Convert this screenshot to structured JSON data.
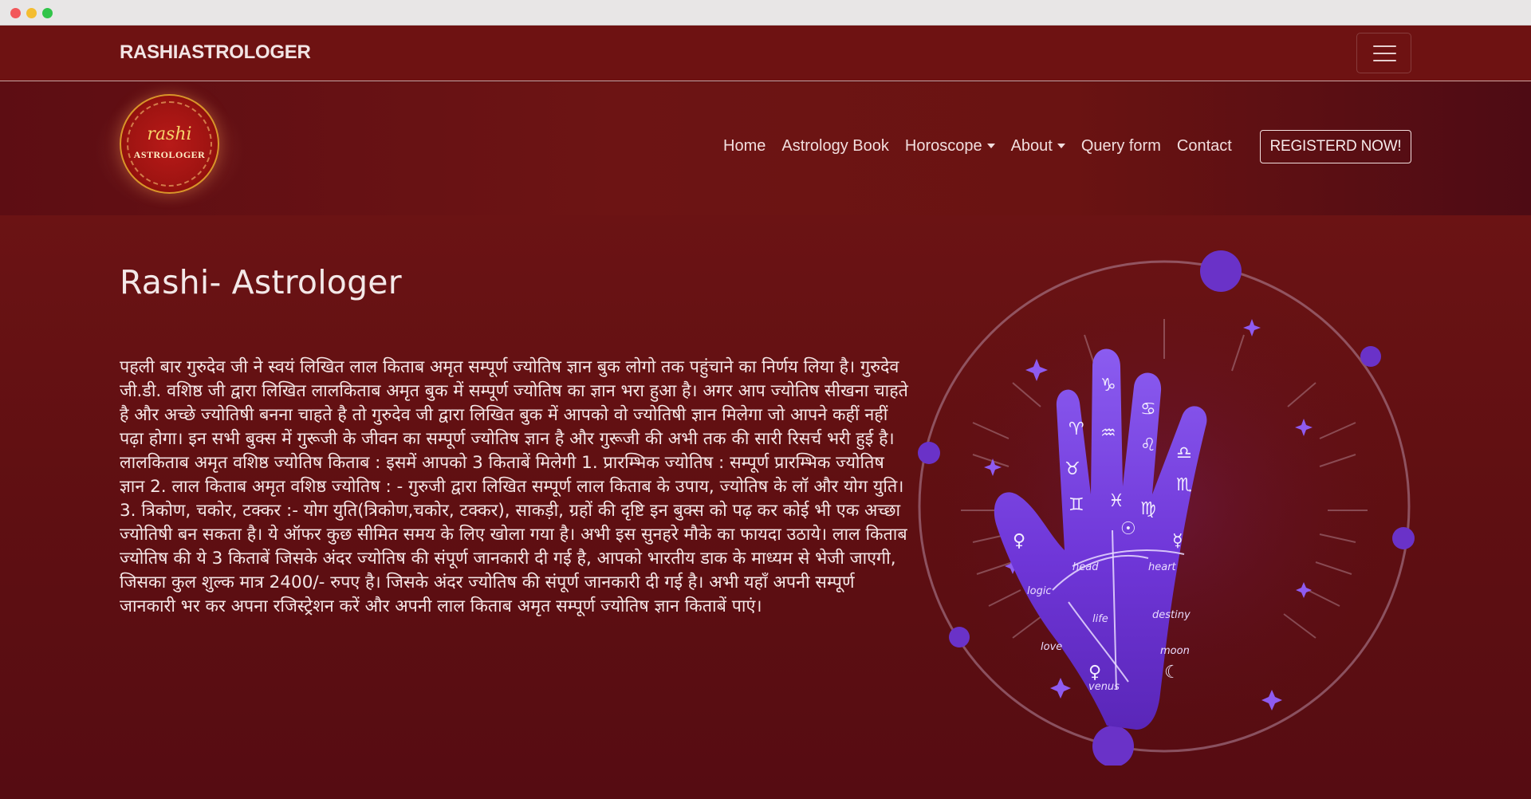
{
  "brand": {
    "name": "RASHIASTROLOGER"
  },
  "logo": {
    "line1": "rashi",
    "line2": "ASTROLOGER"
  },
  "nav": {
    "items": [
      {
        "label": "Home"
      },
      {
        "label": "Astrology Book"
      },
      {
        "label": "Horoscope",
        "dropdown": true
      },
      {
        "label": "About",
        "dropdown": true
      },
      {
        "label": "Query form"
      },
      {
        "label": "Contact"
      }
    ],
    "register_label": "REGISTERD NOW!"
  },
  "main": {
    "title": "Rashi- Astrologer",
    "description": "पहली बार गुरुदेव जी ने स्वयं लिखित लाल किताब अमृत सम्पूर्ण ज्योतिष ज्ञान बुक लोगो तक पहुंचाने का निर्णय लिया है। गुरुदेव जी.डी. वशिष्ठ जी द्वारा लिखित लालकिताब अमृत बुक में सम्पूर्ण ज्योतिष का ज्ञान भरा हुआ है। अगर आप ज्योतिष सीखना चाहते है और अच्छे ज्योतिषी बनना चाहते है तो गुरुदेव जी द्वारा लिखित बुक में आपको वो ज्योतिषी ज्ञान मिलेगा जो आपने कहीं नहीं पढ़ा होगा। इन सभी बुक्स में गुरूजी के जीवन का सम्पूर्ण ज्योतिष ज्ञान है और गुरूजी की अभी तक की सारी रिसर्च भरी हुई है। लालकिताब अमृत वशिष्ठ ज्योतिष किताब : इसमें आपको 3 किताबें मिलेगी 1. प्रारम्भिक ज्योतिष : सम्पूर्ण प्रारम्भिक ज्योतिष ज्ञान 2. लाल किताब अमृत वशिष्ठ ज्योतिष : - गुरुजी द्वारा लिखित सम्पूर्ण लाल किताब के उपाय, ज्योतिष के लॉ और योग युति। 3. त्रिकोण, चकोर, टक्कर :- योग युति(त्रिकोण,चकोर, टक्कर), साकड़ी, ग्रहों की दृष्टि इन बुक्स को पढ़ कर कोई भी एक अच्छा ज्योतिषी बन सकता है। ये ऑफर कुछ सीमित समय के लिए खोला गया है। अभी इस सुनहरे मौके का फायदा उठाये। लाल किताब ज्योतिष की ये 3 किताबें जिसके अंदर ज्योतिष की संपूर्ण जानकारी दी गई है, आपको भारतीय डाक के माध्यम से भेजी जाएगी, जिसका कुल शुल्क मात्र 2400/- रुपए है। जिसके अंदर ज्योतिष की संपूर्ण जानकारी दी गई है। अभी यहाँ अपनी सम्पूर्ण जानकारी भर कर अपना रजिस्ट्रेशन करें और अपनी लाल किताब अमृत सम्पूर्ण ज्योतिष ज्ञान किताबें पाएं।"
  },
  "palm": {
    "labels": {
      "head": "head",
      "heart": "heart",
      "logic": "logic",
      "life": "life",
      "destiny": "destiny",
      "love": "love",
      "moon": "moon",
      "venus": "venus"
    }
  },
  "colors": {
    "page_bg": "#5a0d10",
    "topbar_bg": "#6e1212",
    "palm_purple": "#7b3ee0",
    "orb_purple": "#6a32c8"
  },
  "icons": [
    "hamburger-menu-icon",
    "caret-down-icon",
    "palm-hand-illustration"
  ]
}
